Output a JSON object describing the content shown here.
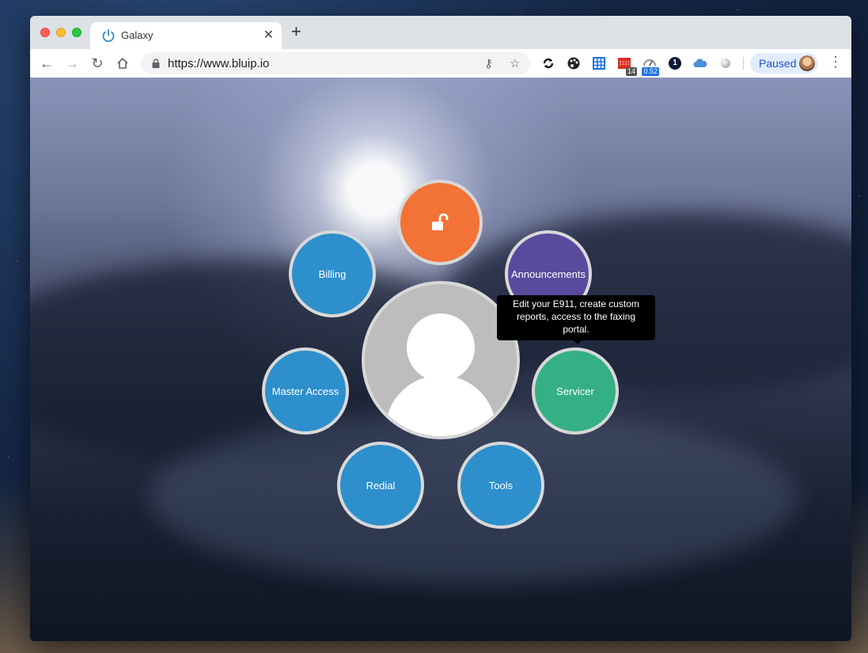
{
  "browser": {
    "tab_title": "Galaxy",
    "new_tab_symbol": "+",
    "close_symbol": "✕",
    "url": "https://www.bluip.io",
    "profile_label": "Paused",
    "menu_symbol": "⋮",
    "extensions": [
      {
        "name": "sync-icon"
      },
      {
        "name": "palette-icon"
      },
      {
        "name": "grid-icon"
      },
      {
        "name": "calendar-icon",
        "badge": "14"
      },
      {
        "name": "speedometer-icon",
        "badge": "0.52"
      },
      {
        "name": "onepassword-icon",
        "label": "1"
      },
      {
        "name": "cloud-icon"
      },
      {
        "name": "circle-icon"
      }
    ]
  },
  "menu": {
    "top_item": {
      "icon": "unlock-icon",
      "color": "#f27335"
    },
    "items": [
      {
        "label": "Billing",
        "color": "#2d8fcb"
      },
      {
        "label": "Announcements",
        "color": "#5a4a9e"
      },
      {
        "label": "Master Access",
        "color": "#2d8fcb"
      },
      {
        "label": "Servicer",
        "color": "#34b084"
      },
      {
        "label": "Redial",
        "color": "#2d8fcb"
      },
      {
        "label": "Tools",
        "color": "#2d8fcb"
      }
    ],
    "tooltip": "Edit your E911, create custom reports, access to the faxing portal."
  }
}
